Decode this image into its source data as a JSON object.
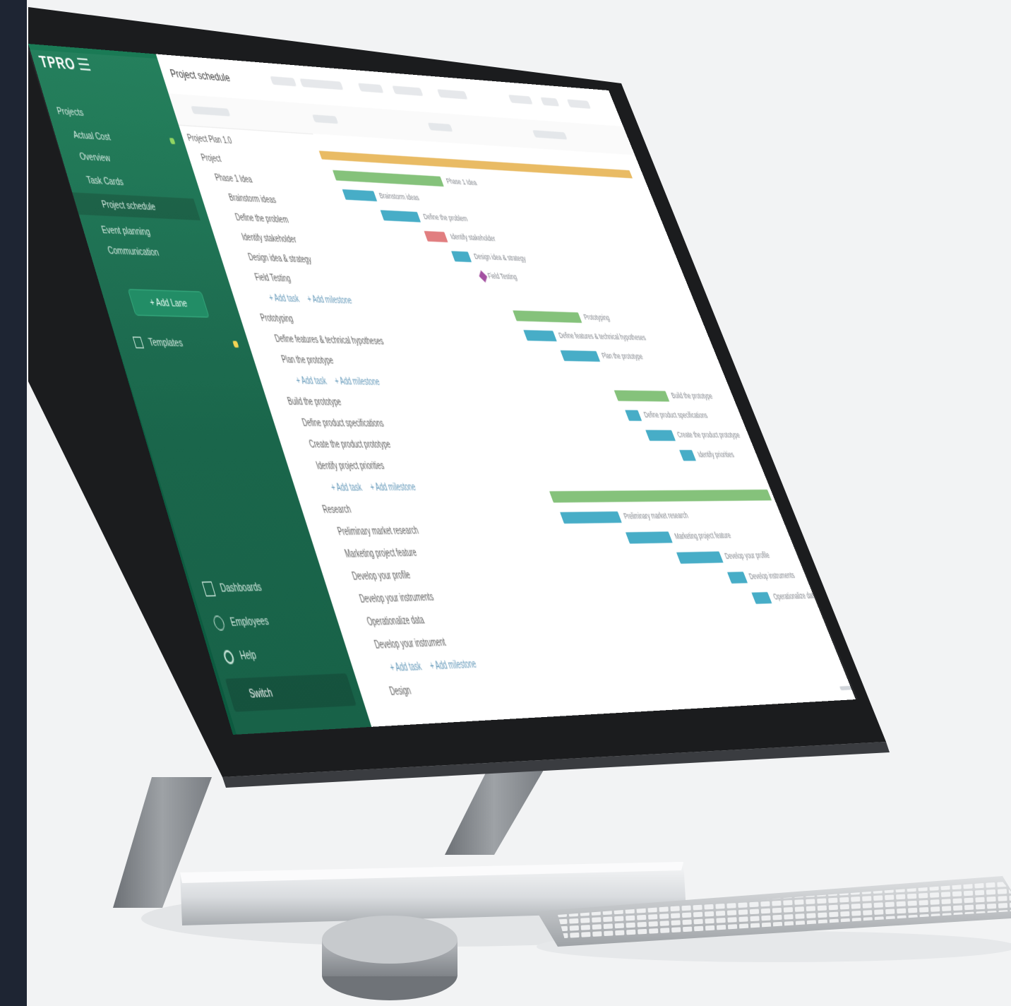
{
  "sidebar": {
    "logo": "TPRO",
    "items": [
      {
        "label": "Projects"
      },
      {
        "label": "Actual Cost"
      },
      {
        "label": "Overview"
      },
      {
        "label": "Task Cards"
      },
      {
        "label": "Project schedule",
        "active": true
      },
      {
        "label": "Event planning"
      },
      {
        "label": "Communication"
      }
    ],
    "add_button": "+ Add Lane",
    "templates": "Templates",
    "footer": [
      {
        "label": "Dashboards",
        "icon": "grid-icon"
      },
      {
        "label": "Employees",
        "icon": "people-icon"
      },
      {
        "label": "Help",
        "icon": "help-icon"
      }
    ],
    "switch": "Switch"
  },
  "header": {
    "title": "Project schedule"
  },
  "tree": [
    {
      "label": "Project Plan 1.0",
      "indent": 0
    },
    {
      "label": "Project",
      "indent": 1
    },
    {
      "label": "Phase 1 Idea",
      "indent": 2
    },
    {
      "label": "Brainstorm ideas",
      "indent": 3
    },
    {
      "label": "Define the problem",
      "indent": 3
    },
    {
      "label": "Identify stakeholder",
      "indent": 3
    },
    {
      "label": "Design idea & strategy",
      "indent": 3
    },
    {
      "label": "Field Testing",
      "indent": 3
    },
    {
      "label": "+ Add task",
      "indent": 4,
      "link": "+ Add milestone"
    },
    {
      "label": "Prototyping",
      "indent": 2
    },
    {
      "label": "Define features & technical hypotheses",
      "indent": 3
    },
    {
      "label": "Plan the prototype",
      "indent": 3
    },
    {
      "label": "+ Add task",
      "indent": 4,
      "link": "+ Add milestone"
    },
    {
      "label": "Build the prototype",
      "indent": 2
    },
    {
      "label": "Define product specifications",
      "indent": 3
    },
    {
      "label": "Create the product prototype",
      "indent": 3
    },
    {
      "label": "Identify project priorities",
      "indent": 3
    },
    {
      "label": "+ Add task",
      "indent": 4,
      "link": "+ Add milestone"
    },
    {
      "label": "Research",
      "indent": 2
    },
    {
      "label": "Preliminary market research",
      "indent": 3
    },
    {
      "label": "Marketing project feature",
      "indent": 3
    },
    {
      "label": "Develop your profile",
      "indent": 3
    },
    {
      "label": "Develop your instruments",
      "indent": 3
    },
    {
      "label": "Operationalize data",
      "indent": 3
    },
    {
      "label": "Develop your instrument",
      "indent": 3
    },
    {
      "label": "+ Add task",
      "indent": 4,
      "link": "+ Add milestone"
    },
    {
      "label": "Design",
      "indent": 3
    }
  ],
  "gantt": {
    "colors": {
      "summary": "#e8b85c",
      "phase": "#7fbf74",
      "task": "#3ea9c4",
      "critical": "#e0787a",
      "milestone": "#a0489d"
    },
    "bars": [
      {
        "row": 0,
        "start": 0.0,
        "end": 0.96,
        "kind": "summary",
        "label": ""
      },
      {
        "row": 1,
        "start": 0.02,
        "end": 0.34,
        "kind": "phase",
        "label": "Phase 1 Idea"
      },
      {
        "row": 2,
        "start": 0.03,
        "end": 0.12,
        "kind": "task",
        "label": "Brainstorm ideas"
      },
      {
        "row": 3,
        "start": 0.12,
        "end": 0.23,
        "kind": "task",
        "label": "Define the problem"
      },
      {
        "row": 4,
        "start": 0.23,
        "end": 0.29,
        "kind": "critical",
        "label": "Identify stakeholder"
      },
      {
        "row": 5,
        "start": 0.29,
        "end": 0.34,
        "kind": "task",
        "label": "Design idea & strategy"
      },
      {
        "row": 6,
        "start": 0.35,
        "end": 0.36,
        "kind": "milestone",
        "label": "Field Testing"
      },
      {
        "row": 8,
        "start": 0.41,
        "end": 0.61,
        "kind": "phase",
        "label": "Prototyping"
      },
      {
        "row": 9,
        "start": 0.42,
        "end": 0.51,
        "kind": "task",
        "label": "Define features & technical hypotheses"
      },
      {
        "row": 10,
        "start": 0.51,
        "end": 0.62,
        "kind": "task",
        "label": "Plan the prototype"
      },
      {
        "row": 12,
        "start": 0.63,
        "end": 0.79,
        "kind": "phase",
        "label": "Build the prototype"
      },
      {
        "row": 13,
        "start": 0.64,
        "end": 0.68,
        "kind": "task",
        "label": "Define product specifications"
      },
      {
        "row": 14,
        "start": 0.68,
        "end": 0.76,
        "kind": "task",
        "label": "Create the product prototype"
      },
      {
        "row": 15,
        "start": 0.76,
        "end": 0.8,
        "kind": "task",
        "label": "Identify priorities"
      },
      {
        "row": 17,
        "start": 0.32,
        "end": 0.99,
        "kind": "phase",
        "label": "Research"
      },
      {
        "row": 18,
        "start": 0.33,
        "end": 0.5,
        "kind": "task",
        "label": "Preliminary market research"
      },
      {
        "row": 19,
        "start": 0.5,
        "end": 0.63,
        "kind": "task",
        "label": "Marketing project feature"
      },
      {
        "row": 20,
        "start": 0.63,
        "end": 0.76,
        "kind": "task",
        "label": "Develop your profile"
      },
      {
        "row": 21,
        "start": 0.76,
        "end": 0.81,
        "kind": "task",
        "label": "Develop instruments"
      },
      {
        "row": 22,
        "start": 0.81,
        "end": 0.86,
        "kind": "task",
        "label": "Operationalize data"
      }
    ]
  }
}
